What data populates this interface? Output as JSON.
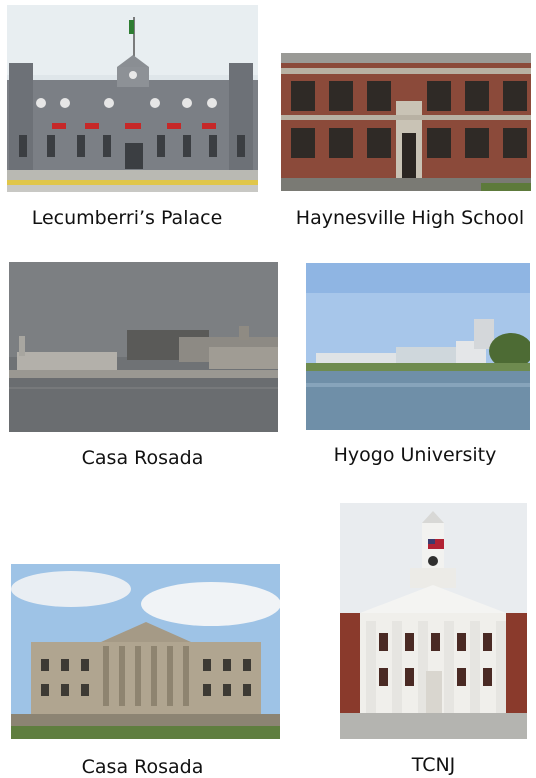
{
  "captions": [
    {
      "label": "Lecumberri’s Palace"
    },
    {
      "label": "Haynesville High School"
    },
    {
      "label": "Casa Rosada"
    },
    {
      "label": "Hyogo University"
    },
    {
      "label": "Casa Rosada"
    },
    {
      "label": "TCNJ"
    }
  ],
  "photos": [
    {
      "subject": "prison-palace-building"
    },
    {
      "subject": "brick-high-school-building"
    },
    {
      "subject": "waterfront-buildings-sepia"
    },
    {
      "subject": "university-by-lake"
    },
    {
      "subject": "neoclassical-mansion"
    },
    {
      "subject": "brick-building-with-cupola"
    }
  ]
}
